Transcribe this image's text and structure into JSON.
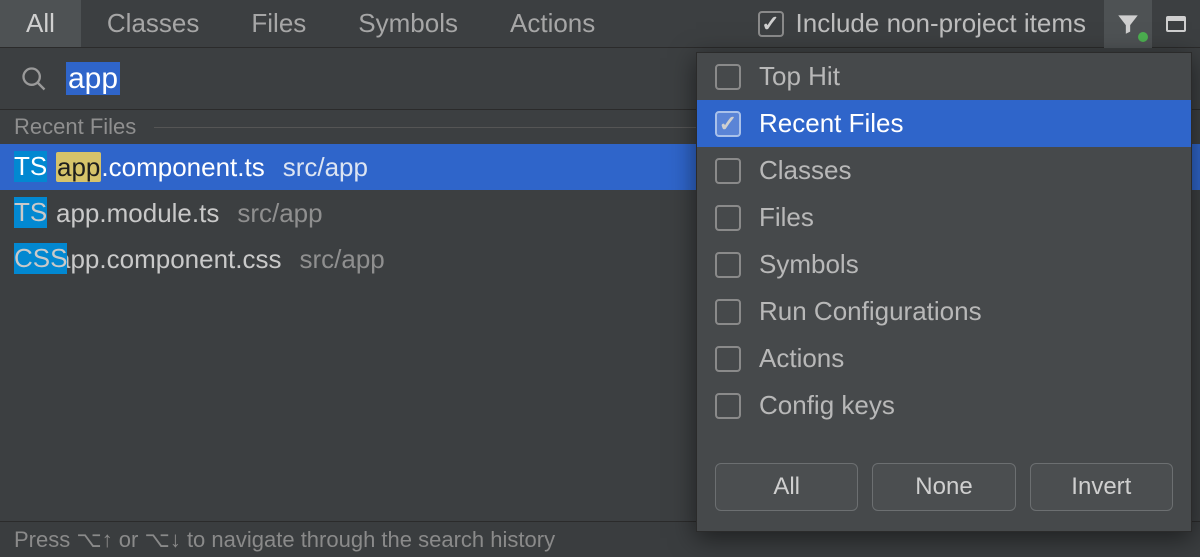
{
  "tabs": {
    "items": [
      {
        "label": "All",
        "active": true
      },
      {
        "label": "Classes",
        "active": false
      },
      {
        "label": "Files",
        "active": false
      },
      {
        "label": "Symbols",
        "active": false
      },
      {
        "label": "Actions",
        "active": false
      }
    ],
    "include_label": "Include non-project items",
    "include_checked": true
  },
  "search": {
    "query": "app"
  },
  "section": {
    "title": "Recent Files"
  },
  "results": [
    {
      "icon": "ts",
      "match": "app",
      "rest": ".component.ts",
      "path": "src/app",
      "selected": true
    },
    {
      "icon": "ts",
      "match": "app",
      "rest": ".module.ts",
      "path": "src/app",
      "selected": false
    },
    {
      "icon": "css",
      "match": "app",
      "rest": ".component.css",
      "path": "src/app",
      "selected": false
    }
  ],
  "filter_panel": {
    "options": [
      {
        "label": "Top Hit",
        "checked": false,
        "selected": false
      },
      {
        "label": "Recent Files",
        "checked": true,
        "selected": true
      },
      {
        "label": "Classes",
        "checked": false,
        "selected": false
      },
      {
        "label": "Files",
        "checked": false,
        "selected": false
      },
      {
        "label": "Symbols",
        "checked": false,
        "selected": false
      },
      {
        "label": "Run Configurations",
        "checked": false,
        "selected": false
      },
      {
        "label": "Actions",
        "checked": false,
        "selected": false
      },
      {
        "label": "Config keys",
        "checked": false,
        "selected": false
      }
    ],
    "buttons": {
      "all": "All",
      "none": "None",
      "invert": "Invert"
    }
  },
  "hint": "Press ⌥↑ or ⌥↓ to navigate through the search history",
  "icons": {
    "ts_label": "TS",
    "css_label": "CSS"
  }
}
